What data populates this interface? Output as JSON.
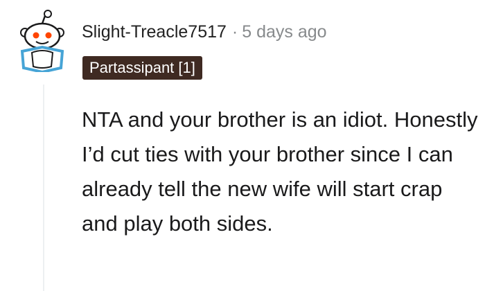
{
  "comment": {
    "username": "Slight-Treacle7517",
    "separator": "·",
    "timestamp": "5 days ago",
    "flair": "Partassipant [1]",
    "body": "NTA and your brother is an idiot. Honestly I’d cut ties with your brother since I can already tell the new wife will start crap and play both sides."
  },
  "colors": {
    "flair_background": "#3f2a22",
    "flair_text": "#ffffff",
    "avatar_accent": "#ff4500",
    "avatar_frame": "#46a4d6",
    "metadata_text": "#878a8c",
    "body_text": "#1a1a1b"
  },
  "icons": {
    "avatar": "snoo-avatar-icon"
  }
}
